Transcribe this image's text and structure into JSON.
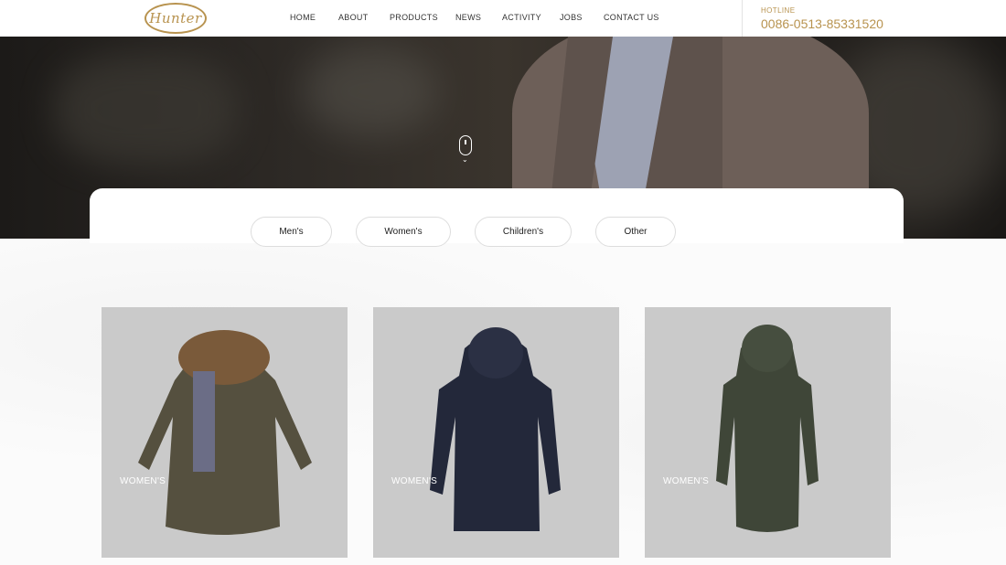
{
  "header": {
    "logo_text": "Hunter",
    "nav": [
      "HOME",
      "ABOUT",
      "PRODUCTS",
      "NEWS",
      "ACTIVITY",
      "JOBS",
      "CONTACT US"
    ],
    "hotline_label": "HOTLINE",
    "hotline_number": "0086-0513-85331520"
  },
  "hero": {
    "scroll_icon": "mouse-scroll-icon"
  },
  "filters": [
    "Men's",
    "Women's",
    "Children's",
    "Other"
  ],
  "products": [
    {
      "label": "WOMEN'S",
      "color": "#55503f",
      "collar": "#7a5a3a"
    },
    {
      "label": "WOMEN'S",
      "color": "#23283a",
      "collar": "#23283a"
    },
    {
      "label": "WOMEN'S",
      "color": "#3f4638",
      "collar": "#3f4638"
    }
  ],
  "colors": {
    "accent": "#b8934f",
    "card_bg": "#cacaca"
  }
}
